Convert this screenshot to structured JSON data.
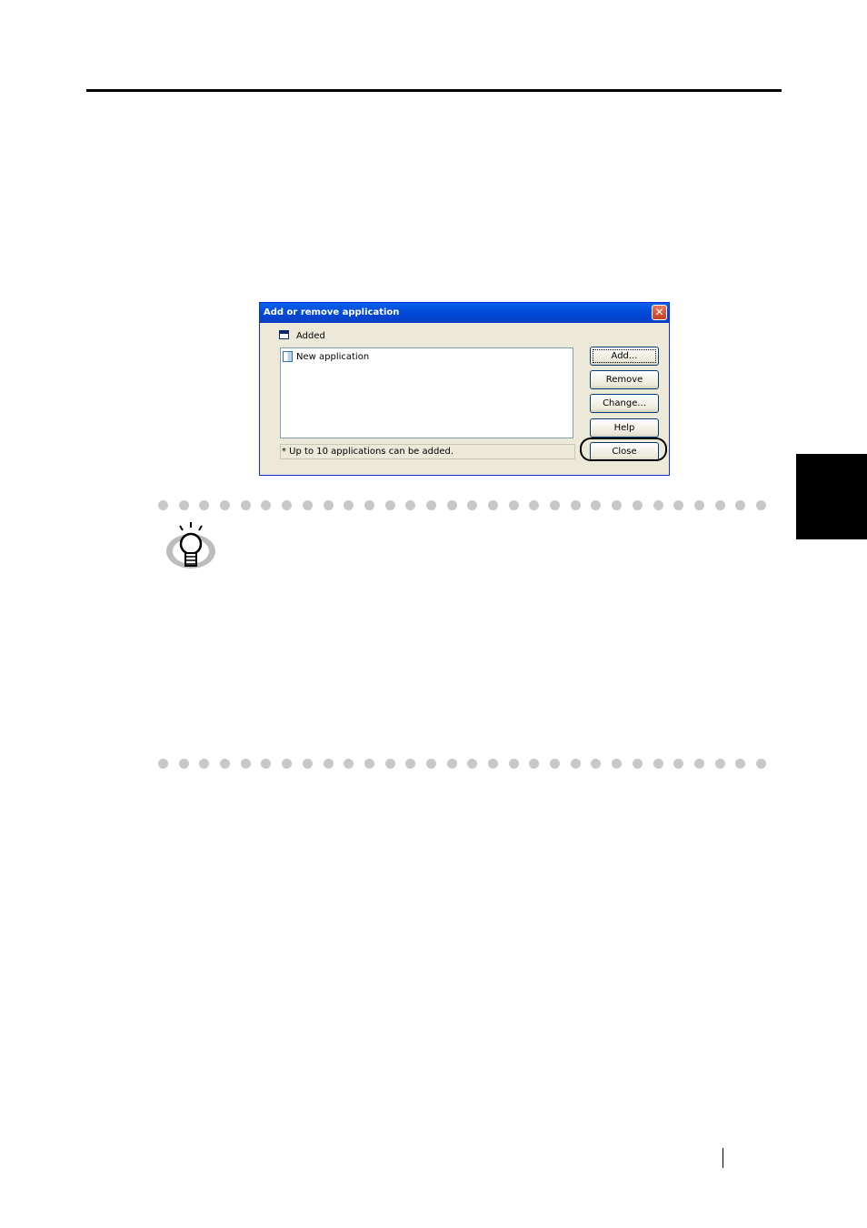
{
  "dialog": {
    "title": "Add or remove application",
    "close_glyph": "✕",
    "group_label": "Added",
    "list_items": [
      "New application"
    ],
    "footnote": "* Up to 10 applications can be added.",
    "buttons": {
      "add": "Add...",
      "remove": "Remove",
      "change": "Change...",
      "help": "Help",
      "close": "Close"
    }
  },
  "icons": {
    "hint": "lightbulb-icon",
    "window": "window-icon",
    "application": "application-icon"
  },
  "colors": {
    "titlebar": "#0a5fe9",
    "dialog_bg": "#ece9d8",
    "hint_dots": "#c8c8c8"
  }
}
